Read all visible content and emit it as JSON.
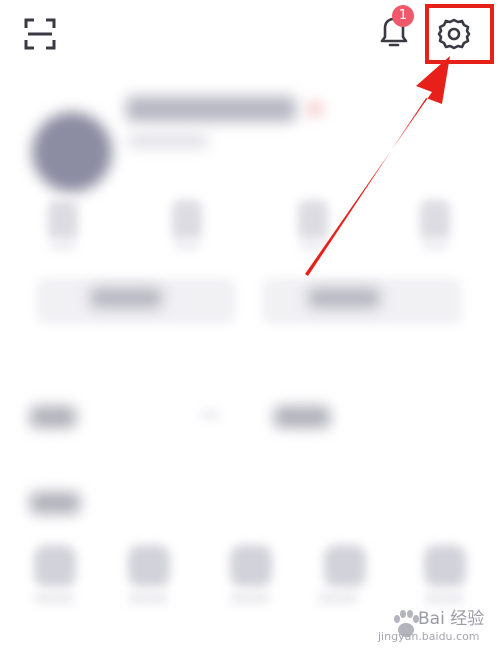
{
  "header": {
    "scan_icon": "scan-icon",
    "bell_icon": "bell-icon",
    "notification_count": "1",
    "settings_icon": "gear-icon"
  },
  "annotation": {
    "highlight_color": "#e8201a"
  },
  "watermark": {
    "text": "Bai 经验",
    "url": "jingyan.baidu.com"
  }
}
